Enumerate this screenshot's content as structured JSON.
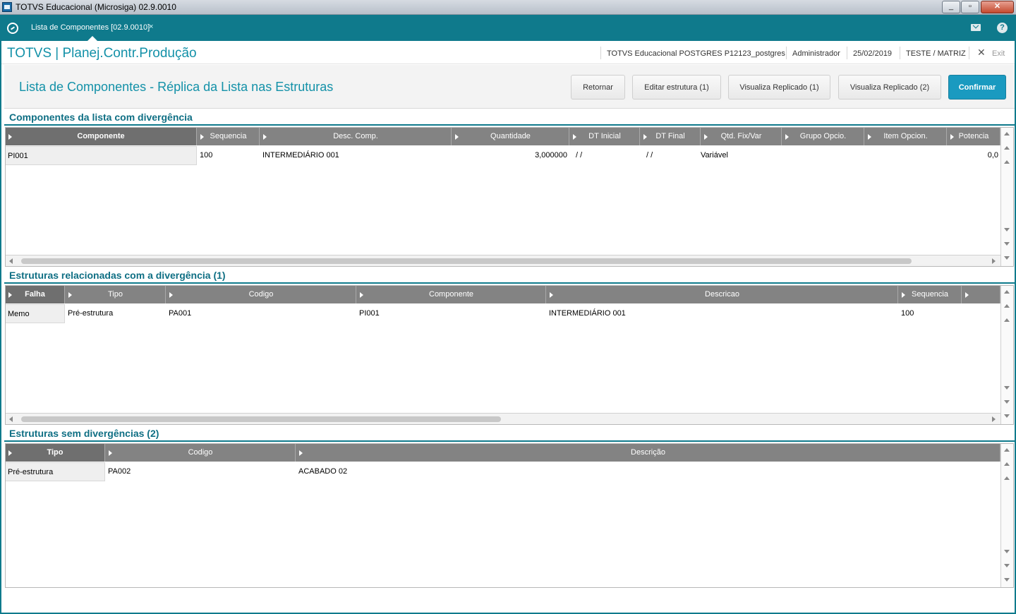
{
  "window": {
    "title": "TOTVS Educacional (Microsiga) 02.9.0010"
  },
  "tabbar": {
    "active_tab": "Lista de Componentes [02.9.0010]",
    "close_glyph": "×"
  },
  "header": {
    "module": "TOTVS | Planej.Contr.Produção",
    "environment": "TOTVS Educacional POSTGRES P12123_postgres",
    "user": "Administrador",
    "date": "25/02/2019",
    "company": "TESTE / MATRIZ",
    "exit_label": "Exit"
  },
  "toolbar": {
    "page_title": "Lista de Componentes - Réplica da Lista nas Estruturas",
    "buttons": {
      "retornar": "Retornar",
      "editar": "Editar estrutura (1)",
      "vis1": "Visualiza Replicado (1)",
      "vis2": "Visualiza Replicado (2)",
      "confirmar": "Confirmar"
    }
  },
  "section1": {
    "title": "Componentes da lista com divergência",
    "columns": [
      "Componente",
      "Sequencia",
      "Desc. Comp.",
      "Quantidade",
      "DT Inicial",
      "DT Final",
      "Qtd. Fix/Var",
      "Grupo Opcio.",
      "Item Opcion.",
      "Potencia"
    ],
    "row": [
      "PI001",
      "100",
      "INTERMEDIÁRIO 001",
      "3,000000",
      "/ /",
      "/ /",
      "Variável",
      "",
      "",
      "0,0"
    ]
  },
  "section2": {
    "title": "Estruturas relacionadas com a divergência (1)",
    "columns": [
      "Falha",
      "Tipo",
      "Codigo",
      "Componente",
      "Descricao",
      "Sequencia",
      ""
    ],
    "row": [
      "Memo",
      "Pré-estrutura",
      "PA001",
      "PI001",
      "INTERMEDIÁRIO 001",
      "100",
      ""
    ]
  },
  "section3": {
    "title": "Estruturas sem divergências (2)",
    "columns": [
      "Tipo",
      "Codigo",
      "Descrição"
    ],
    "row": [
      "Pré-estrutura",
      "PA002",
      "ACABADO 02"
    ]
  },
  "colors": {
    "teal": "#0f7a8c",
    "accent": "#1391a8",
    "confirm": "#1a9ac0",
    "header_gray": "#838383"
  }
}
